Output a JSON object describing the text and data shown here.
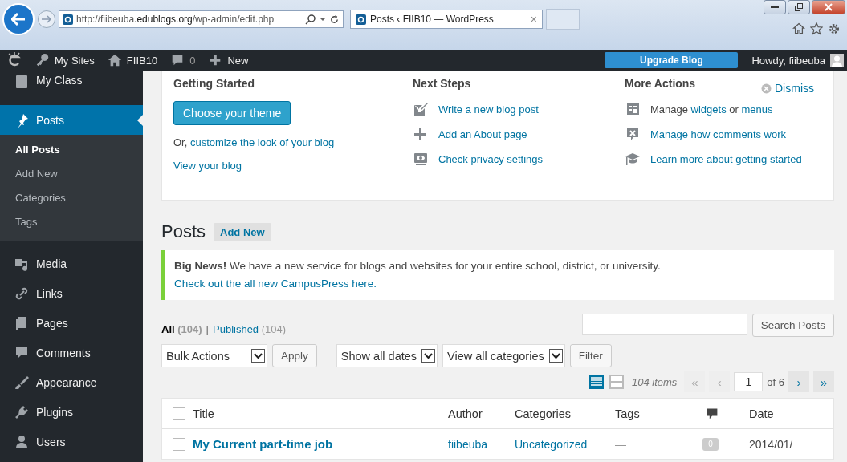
{
  "browser": {
    "address": "http://fiibeuba.**edublogs.org**/wp-admin/edit.php",
    "tab": {
      "title": "Posts ‹ FIIB10 — WordPress",
      "close": "×"
    }
  },
  "admin_bar": {
    "items": [
      {
        "kind": "sites",
        "label": "My Sites"
      },
      {
        "kind": "home",
        "label": "FIIB10"
      },
      {
        "kind": "comments",
        "label": "0"
      },
      {
        "kind": "new",
        "label": "New"
      }
    ],
    "upgrade": "Upgrade Blog",
    "howdy": "Howdy, fiibeuba"
  },
  "sidebar": {
    "items": [
      {
        "label": "My Class",
        "selected": false
      },
      {
        "label": "Posts",
        "selected": true,
        "children": [
          {
            "label": "All Posts",
            "selected": true
          },
          {
            "label": "Add New",
            "selected": false
          },
          {
            "label": "Categories",
            "selected": false
          },
          {
            "label": "Tags",
            "selected": false
          }
        ]
      },
      {
        "label": "Media",
        "selected": false
      },
      {
        "label": "Links",
        "selected": false
      },
      {
        "label": "Pages",
        "selected": false
      },
      {
        "label": "Comments",
        "selected": false
      },
      {
        "label": "Appearance",
        "selected": false
      },
      {
        "label": "Plugins",
        "selected": false
      },
      {
        "label": "Users",
        "selected": false
      }
    ]
  },
  "welcome": {
    "dismiss": "Dismiss",
    "columns": [
      {
        "title": "Getting Started",
        "button": "Choose your theme",
        "lines": [
          [
            {
              "text": "Or, ",
              "link": false
            },
            {
              "text": "customize the look of your blog",
              "link": true
            }
          ],
          [
            {
              "text": "View your blog",
              "link": true
            }
          ]
        ]
      },
      {
        "title": "Next Steps",
        "items": [
          {
            "parts": [
              {
                "text": "Write a new blog post",
                "link": true
              }
            ]
          },
          {
            "parts": [
              {
                "text": "Add an About page",
                "link": true
              }
            ]
          },
          {
            "parts": [
              {
                "text": "Check privacy settings",
                "link": true
              }
            ]
          }
        ]
      },
      {
        "title": "More Actions",
        "items": [
          {
            "parts": [
              {
                "text": "Manage ",
                "link": false
              },
              {
                "text": "widgets",
                "link": true
              },
              {
                "text": " or ",
                "link": false
              },
              {
                "text": "menus",
                "link": true
              }
            ]
          },
          {
            "parts": [
              {
                "text": "Manage how comments work",
                "link": true
              }
            ]
          },
          {
            "parts": [
              {
                "text": "Learn more about getting started",
                "link": true
              }
            ]
          }
        ]
      }
    ]
  },
  "page_title": "Posts",
  "add_new": "Add New",
  "notice": {
    "text": "**Big News!** We have a new service for blogs and websites for your entire school, district, or university.",
    "link": "Check out the all new CampusPress here."
  },
  "views": [
    {
      "label": "All",
      "count": "(104)",
      "selected": true
    },
    {
      "label": "Published",
      "count": "(104)",
      "selected": false
    }
  ],
  "views_separator": "|",
  "search_button": "Search Posts",
  "filters": {
    "bulk": "Bulk Actions",
    "apply": "Apply",
    "dates": "Show all dates",
    "categories": "View all categories",
    "filter": "Filter"
  },
  "view_modes": [
    {
      "kind": "list",
      "selected": true
    },
    {
      "kind": "excerpt",
      "selected": false
    }
  ],
  "pagination": {
    "count": "104 items",
    "first": "«",
    "prev": "‹",
    "page": "1",
    "of": "of 6",
    "next": "›",
    "last": "»"
  },
  "table": {
    "columns": [
      "Title",
      "Author",
      "Categories",
      "Tags",
      "Date"
    ],
    "select_all_checked": false,
    "rows": [
      {
        "checked": false,
        "title": "My Current part-time job",
        "author": "fiibeuba",
        "category": "Uncategorized",
        "tags": "—",
        "comments": "0",
        "date": "2014/01/"
      }
    ]
  }
}
